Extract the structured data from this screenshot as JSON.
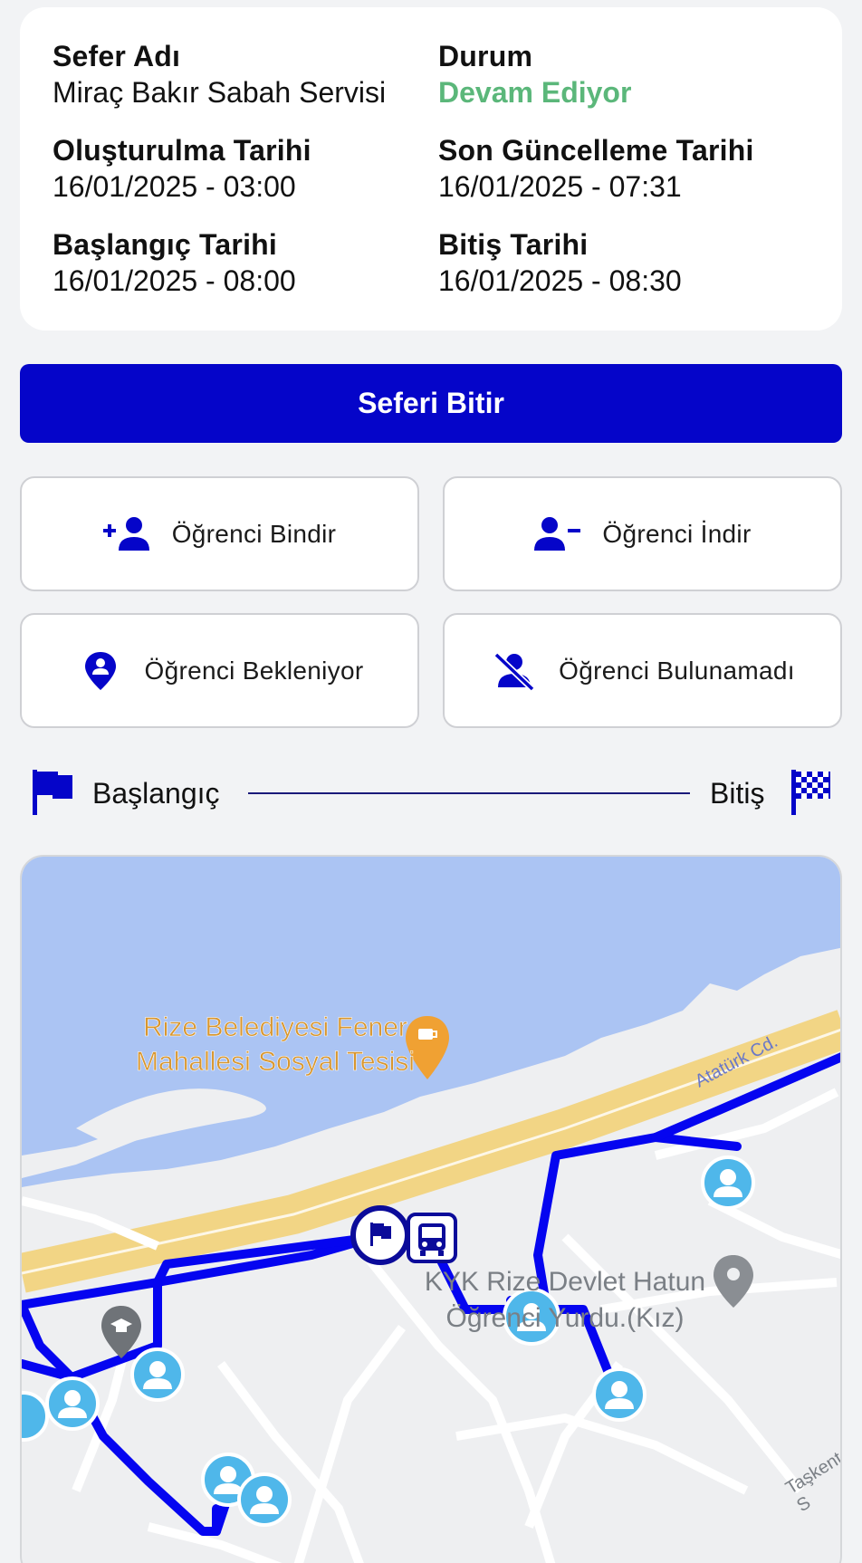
{
  "trip": {
    "name_label": "Sefer Adı",
    "name_value": "Miraç Bakır Sabah Servisi",
    "status_label": "Durum",
    "status_value": "Devam Ediyor",
    "created_label": "Oluşturulma Tarihi",
    "created_value": "16/01/2025 - 03:00",
    "updated_label": "Son Güncelleme Tarihi",
    "updated_value": "16/01/2025 - 07:31",
    "start_label": "Başlangıç Tarihi",
    "start_value": "16/01/2025 - 08:00",
    "end_label": "Bitiş Tarihi",
    "end_value": "16/01/2025 - 08:30",
    "status_color": "#5bb77a"
  },
  "finish_button": {
    "label": "Seferi Bitir",
    "color": "#0505c9"
  },
  "actions": {
    "board": {
      "label": "Öğrenci Bindir",
      "icon": "person-add-icon"
    },
    "drop": {
      "label": "Öğrenci İndir",
      "icon": "person-remove-icon"
    },
    "waiting": {
      "label": "Öğrenci Bekleniyor",
      "icon": "map-pin-person-icon"
    },
    "not_found": {
      "label": "Öğrenci Bulunamadı",
      "icon": "person-off-icon"
    }
  },
  "route": {
    "start_label": "Başlangıç",
    "end_label": "Bitiş"
  },
  "map": {
    "poi_line1": "Rize Belediyesi Fener",
    "poi_line2": "Mahallesi Sosyal Tesisi",
    "dorm_line1": "KYK Rize Devlet Hatun",
    "dorm_line2": "Öğrenci Yurdu.(Kız)",
    "street1": "Atatürk Cd.",
    "street2": "Taşkent S"
  }
}
